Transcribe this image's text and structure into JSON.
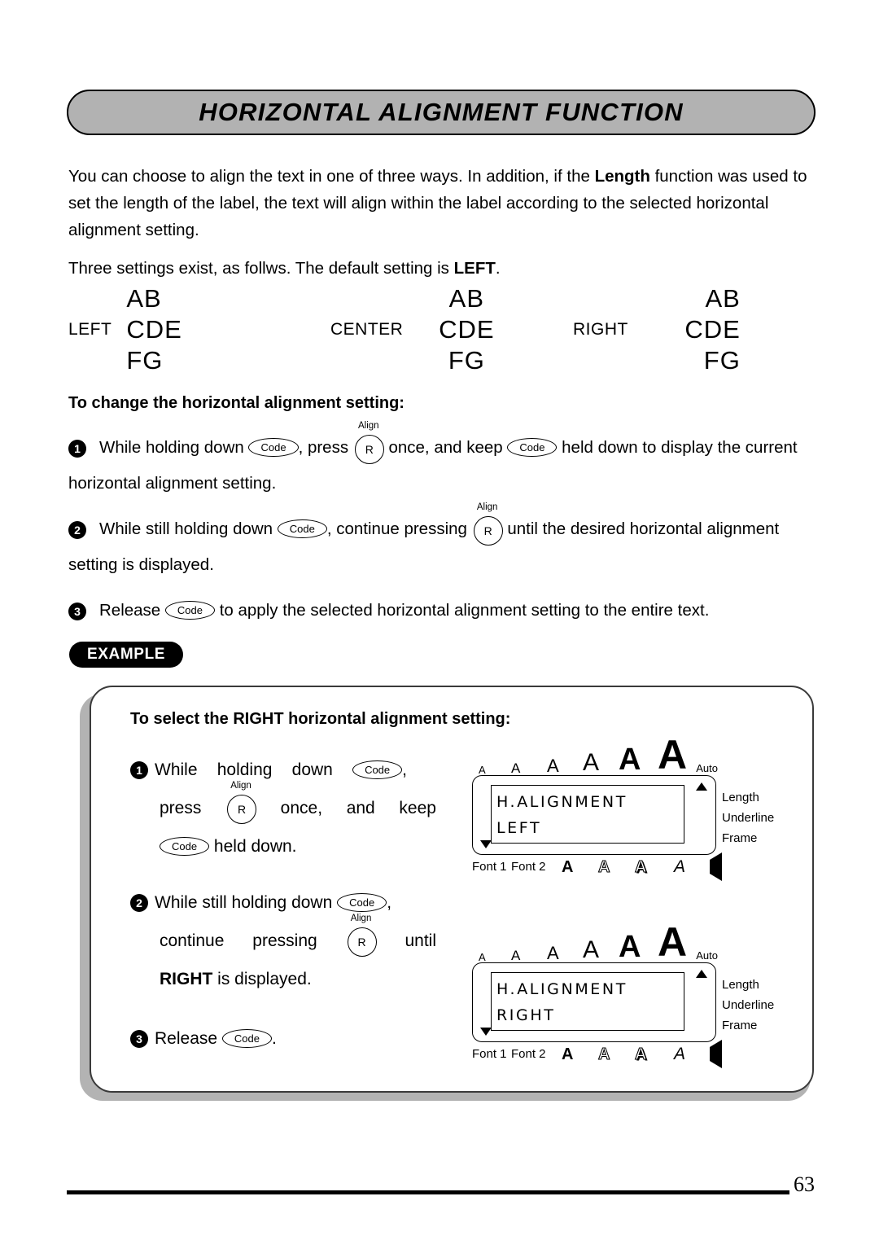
{
  "page": {
    "title": "HORIZONTAL ALIGNMENT FUNCTION",
    "page_number": "63"
  },
  "intro": {
    "para1_part1": "You can choose to align the text in one of three ways. In addition, if the ",
    "para1_bold": "Length",
    "para1_part2": " function was used to set the length of the label, the text will align within the label according to the selected horizontal alignment setting.",
    "para2_part1": "Three settings exist, as follws. The default setting is ",
    "para2_bold": "LEFT",
    "para2_part2": "."
  },
  "samples": {
    "lines": [
      "AB",
      "CDE",
      "FG"
    ],
    "left_label": "LEFT",
    "center_label": "CENTER",
    "right_label": "RIGHT"
  },
  "procedure": {
    "heading": "To change the horizontal alignment setting:",
    "steps": [
      {
        "number": "1",
        "t1": "While holding down ",
        "key1": "Code",
        "t2": ", press ",
        "key2": "R",
        "key2_sup": "Align",
        "t3": " once, and keep ",
        "key3": "Code",
        "t4": " held down to display the current horizontal alignment setting."
      },
      {
        "number": "2",
        "t1": "While still holding down ",
        "key1": "Code",
        "t2": ", continue pressing ",
        "key2": "R",
        "key2_sup": "Align",
        "t3": " until the desired horizontal alignment setting is displayed."
      },
      {
        "number": "3",
        "t1": "Release ",
        "key1": "Code",
        "t2": " to apply the selected horizontal alignment setting to the entire text."
      }
    ]
  },
  "example": {
    "badge": "EXAMPLE",
    "heading": "To select the RIGHT horizontal alignment setting:",
    "step1": {
      "number": "1",
      "w1": "While",
      "w2": "holding",
      "w3": "down",
      "key1": "Code",
      "comma": ",",
      "w4": "press",
      "key2": "R",
      "key2_sup": "Align",
      "w5": "once,",
      "w6": "and",
      "w7": "keep",
      "key3": "Code",
      "w8": "held down."
    },
    "step2": {
      "number": "2",
      "t1": "While still holding down",
      "key1": "Code",
      "comma": ",",
      "w1": "continue",
      "w2": "pressing",
      "key2": "R",
      "key2_sup": "Align",
      "w3": "until",
      "bold_word": "RIGHT",
      "t2": " is displayed."
    },
    "step3": {
      "number": "3",
      "t1": "Release",
      "key1": "Code",
      "period": "."
    },
    "displays": [
      {
        "line1": "H.ALIGNMENT",
        "line2": "LEFT",
        "auto_label": "Auto",
        "size_marks": [
          "A",
          "A",
          "A",
          "A",
          "A",
          "A"
        ],
        "right_labels": [
          "Length",
          "Underline",
          "Frame"
        ],
        "bottom_labels": [
          "Font 1",
          "Font 2"
        ],
        "bottom_styles": [
          "A",
          "A",
          "A",
          "A"
        ],
        "arrow_icon": "triangle-left-icon"
      },
      {
        "line1": "H.ALIGNMENT",
        "line2": "RIGHT",
        "auto_label": "Auto",
        "size_marks": [
          "A",
          "A",
          "A",
          "A",
          "A",
          "A"
        ],
        "right_labels": [
          "Length",
          "Underline",
          "Frame"
        ],
        "bottom_labels": [
          "Font 1",
          "Font 2"
        ],
        "bottom_styles": [
          "A",
          "A",
          "A",
          "A"
        ],
        "arrow_icon": "triangle-left-icon"
      }
    ]
  },
  "colors": {
    "banner_fill": "#b2b2b2",
    "shadow": "#b3b3b3",
    "ink": "#000000"
  }
}
